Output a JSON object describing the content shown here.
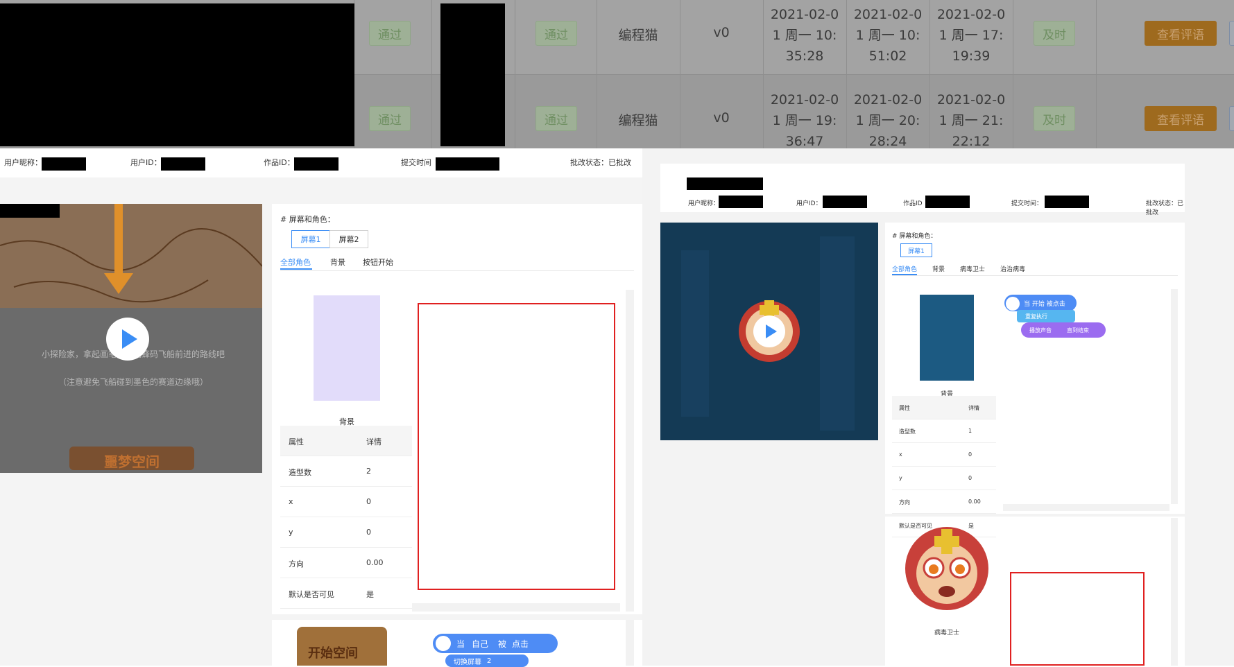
{
  "table": {
    "rows": [
      {
        "status_tag_1": "通过",
        "status_tag_2": "通过",
        "platform": "编程猫",
        "version": "v0",
        "time1": "2021-02-0\n1 周一 10:\n35:28",
        "time2": "2021-02-0\n1 周一 10:\n51:02",
        "time3": "2021-02-0\n1 周一 17:\n19:39",
        "timely": "及时",
        "action": "查看评语"
      },
      {
        "status_tag_1": "通过",
        "status_tag_2": "通过",
        "platform": "编程猫",
        "version": "v0",
        "time1": "2021-02-0\n1 周一 19:\n36:47",
        "time2": "2021-02-0\n1 周一 20:\n28:24",
        "time3": "2021-02-0\n1 周一 21:\n22:12",
        "timely": "及时",
        "action": "查看评语"
      }
    ]
  },
  "left": {
    "info": {
      "nickname_label": "用户昵称：",
      "user_id_label": "用户ID：",
      "work_id_label": "作品ID：",
      "submit_time_label": "提交时间",
      "status": "批改状态：已批改"
    },
    "video": {
      "line1": "小探险家，拿起画笔，绘制蜂码飞船前进的路线吧",
      "line2": "（注意避免飞船碰到墨色的赛道边缘哦）",
      "logo": "噩梦空间"
    },
    "section_title": "# 屏幕和角色：",
    "screen_tabs": [
      "屏幕1",
      "屏幕2"
    ],
    "sub_tabs": [
      "全部角色",
      "背景",
      "按钮开始"
    ],
    "sprite_caption": "背景",
    "props": {
      "header": [
        "属性",
        "详情"
      ],
      "rows": [
        [
          "造型数",
          "2"
        ],
        [
          "x",
          "0"
        ],
        [
          "y",
          "0"
        ],
        [
          "方向",
          "0.00"
        ],
        [
          "默认是否可见",
          "是"
        ]
      ]
    },
    "blocks": {
      "b1_when": "当",
      "b1_self": "自己",
      "b1_clicked": "被",
      "b1_click": "点击",
      "b2": "切换屏幕",
      "b2_val": "2"
    },
    "bottom_sprite_label": "开始空间"
  },
  "right": {
    "info": {
      "nickname_label": "用户昵称：",
      "user_id_label": "用户ID：",
      "work_id_label": "作品ID",
      "submit_time_label": "提交时间：",
      "status": "批改状态：已批改"
    },
    "section_title": "# 屏幕和角色：",
    "screen_tabs": [
      "屏幕1"
    ],
    "sub_tabs": [
      "全部角色",
      "背景",
      "病毒卫士",
      "治治病毒"
    ],
    "sprite_caption": "背景",
    "props": {
      "header": [
        "属性",
        "详情"
      ],
      "rows": [
        [
          "造型数",
          "1"
        ],
        [
          "x",
          "0"
        ],
        [
          "y",
          "0"
        ],
        [
          "方向",
          "0.00"
        ],
        [
          "默认是否可见",
          "是"
        ]
      ]
    },
    "blocks": {
      "b1": "当 开始 被点击",
      "b2": "重复执行",
      "b3": "播放声音",
      "b3b": "直到结束"
    },
    "bottom_sprite_caption": "病毒卫士"
  }
}
